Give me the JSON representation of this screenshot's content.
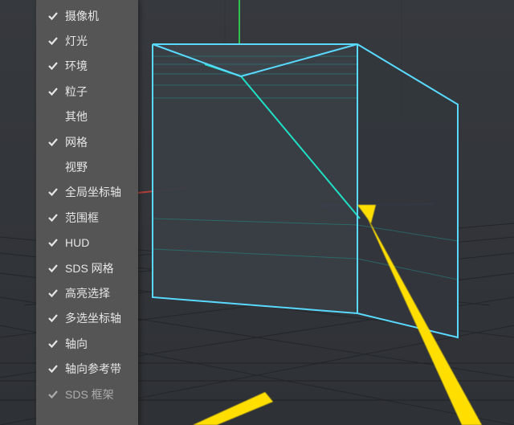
{
  "menu": {
    "items": [
      {
        "label": "摄像机",
        "checked": true
      },
      {
        "label": "灯光",
        "checked": true
      },
      {
        "label": "环境",
        "checked": true
      },
      {
        "label": "粒子",
        "checked": true
      },
      {
        "label": "其他",
        "checked": false
      },
      {
        "label": "网格",
        "checked": true
      },
      {
        "label": "视野",
        "checked": false
      },
      {
        "label": "全局坐标轴",
        "checked": true
      },
      {
        "label": "范围框",
        "checked": true
      },
      {
        "label": "HUD",
        "checked": true
      },
      {
        "label": "SDS 网格",
        "checked": true
      },
      {
        "label": "高亮选择",
        "checked": true
      },
      {
        "label": "多选坐标轴",
        "checked": true
      },
      {
        "label": "轴向",
        "checked": true
      },
      {
        "label": "轴向参考带",
        "checked": true
      },
      {
        "label": "SDS 框架",
        "checked": true
      }
    ]
  },
  "scene": {
    "object": "cube",
    "wire_color": "#2fd3c8",
    "selection_color": "#62e3ff",
    "grid_color": "#2b2e32",
    "x_axis_color": "#b13f38",
    "y_axis_color": "#33c24d",
    "z_axis_color": "#3855c9"
  },
  "annotations": {
    "arrow_color": "#ffde00"
  }
}
